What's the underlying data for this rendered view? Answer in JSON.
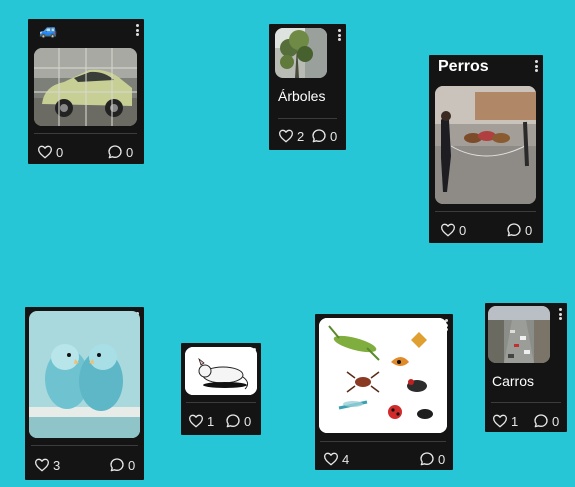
{
  "cards": [
    {
      "id": "car",
      "title": "🚙",
      "likes": "0",
      "comments": "0",
      "image": "car-photo"
    },
    {
      "id": "trees",
      "title": "Árboles",
      "likes": "2",
      "comments": "0",
      "image": "tree-photo"
    },
    {
      "id": "dogs",
      "title": "Perros",
      "likes": "0",
      "comments": "0",
      "image": "dogs-photo"
    },
    {
      "id": "birds",
      "title": "",
      "likes": "3",
      "comments": "0",
      "image": "parakeets-photo"
    },
    {
      "id": "rat",
      "title": "",
      "likes": "1",
      "comments": "0",
      "image": "rat-drawing"
    },
    {
      "id": "insects",
      "title": "",
      "likes": "4",
      "comments": "0",
      "image": "insects-photo"
    },
    {
      "id": "cars",
      "title": "Carros",
      "likes": "1",
      "comments": "0",
      "image": "traffic-photo"
    }
  ],
  "icons": {
    "like": "heart-icon",
    "comment": "comment-icon",
    "menu": "more-vertical-icon"
  },
  "colors": {
    "background": "#27c6d6",
    "card": "#141414",
    "text": "#ffffff"
  }
}
